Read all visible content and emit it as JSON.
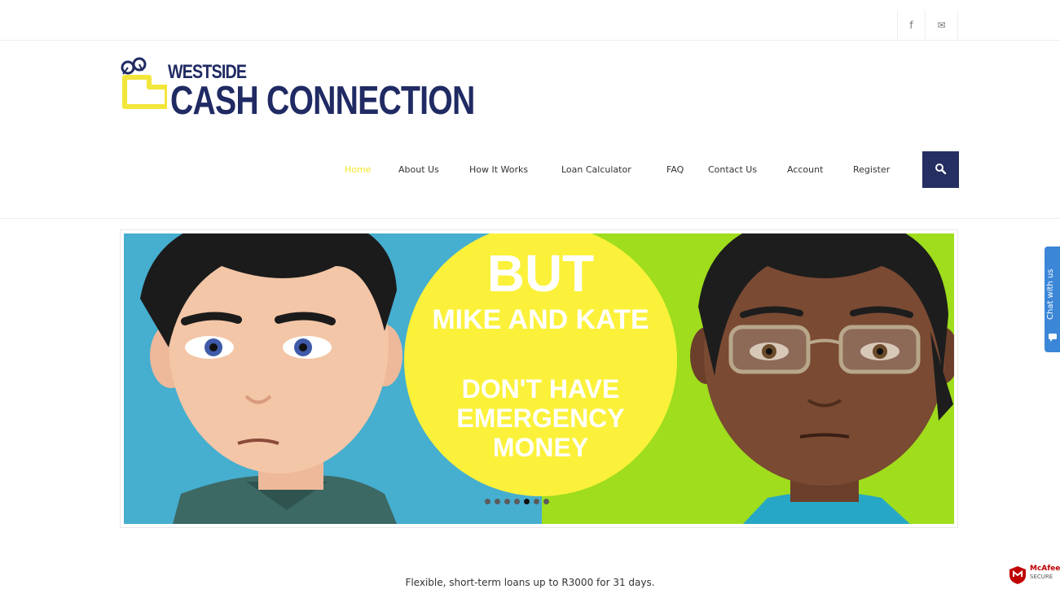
{
  "topbar": {
    "facebook_glyph": "f",
    "mail_glyph": "✉",
    "icons": [
      "facebook-icon",
      "mail-icon"
    ]
  },
  "logo": {
    "line1": "WESTSIDE",
    "line2": "CASH CONNECTION",
    "colors": {
      "text": "#202a63",
      "mark": "#f3e63a"
    }
  },
  "nav": {
    "items": [
      {
        "label": "Home",
        "active": true
      },
      {
        "label": "About Us",
        "active": false
      },
      {
        "label": "How It Works",
        "active": false
      },
      {
        "label": "Loan Calculator",
        "active": false
      },
      {
        "label": "FAQ",
        "active": false
      },
      {
        "label": "Contact Us",
        "active": false
      },
      {
        "label": "Account",
        "active": false
      },
      {
        "label": "Register",
        "active": false
      }
    ],
    "active_color": "#f5e52a",
    "search_icon": "search-icon",
    "search_bg": "#252f61"
  },
  "slider": {
    "line1": "BUT",
    "line2": "MIKE AND KATE",
    "line3": "DON'T HAVE",
    "line4": "EMERGENCY",
    "line5": "MONEY",
    "dots_total": 7,
    "dots_active_index": 4,
    "colors": {
      "left_bg": "#46aecf",
      "right_bg": "#9fdd1d",
      "circle": "#fbf13a"
    }
  },
  "chat": {
    "label": "Chat with us",
    "color": "#3b86d6",
    "icon": "chat-bubble-icon"
  },
  "tagline": "Flexible, short-term loans up to R3000 for 31 days.",
  "badge": {
    "title": "McAfee",
    "subtitle": "SECURE",
    "icon": "mcafee-shield-icon"
  }
}
